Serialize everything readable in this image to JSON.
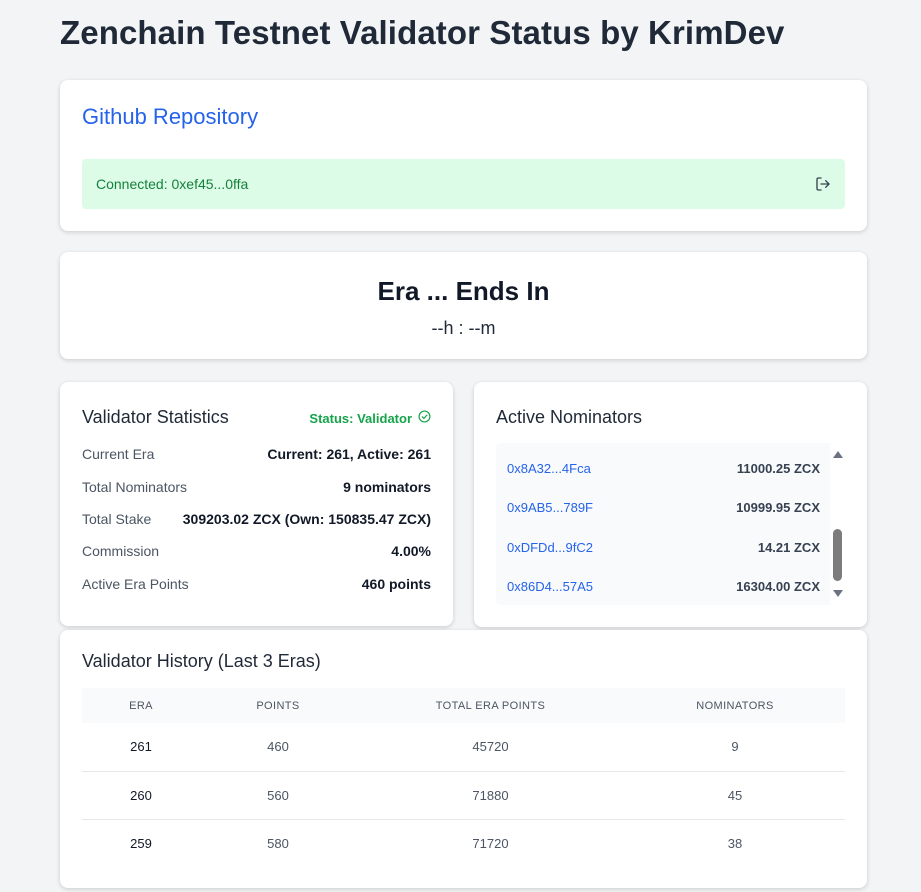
{
  "page": {
    "title": "Zenchain Testnet Validator Status by KrimDev"
  },
  "repo": {
    "link_label": "Github Repository"
  },
  "connection": {
    "text": "Connected: 0xef45...0ffa",
    "icon": "logout-icon"
  },
  "era": {
    "title": "Era ... Ends In",
    "countdown": "--h : --m"
  },
  "stats": {
    "title": "Validator Statistics",
    "status": "Status: Validator",
    "rows": [
      {
        "label": "Current Era",
        "value": "Current: 261, Active: 261"
      },
      {
        "label": "Total Nominators",
        "value": "9 nominators"
      },
      {
        "label": "Total Stake",
        "value": "309203.02 ZCX (Own: 150835.47 ZCX)"
      },
      {
        "label": "Commission",
        "value": "4.00%"
      },
      {
        "label": "Active Era Points",
        "value": "460 points"
      }
    ]
  },
  "nominators": {
    "title": "Active Nominators",
    "items": [
      {
        "address": "0x8A32...4Fca",
        "amount": "11000.25 ZCX"
      },
      {
        "address": "0x9AB5...789F",
        "amount": "10999.95 ZCX"
      },
      {
        "address": "0xDFDd...9fC2",
        "amount": "14.21 ZCX"
      },
      {
        "address": "0x86D4...57A5",
        "amount": "16304.00 ZCX"
      }
    ]
  },
  "history": {
    "title": "Validator History (Last 3 Eras)",
    "columns": [
      "Era",
      "Points",
      "Total Era Points",
      "Nominators"
    ],
    "rows": [
      {
        "era": "261",
        "points": "460",
        "total": "45720",
        "nominators": "9"
      },
      {
        "era": "260",
        "points": "560",
        "total": "71880",
        "nominators": "45"
      },
      {
        "era": "259",
        "points": "580",
        "total": "71720",
        "nominators": "38"
      }
    ]
  },
  "colors": {
    "accent": "#2563eb",
    "success": "#16a34a",
    "success_bg": "#dcfce7",
    "background": "#f3f4f6"
  }
}
